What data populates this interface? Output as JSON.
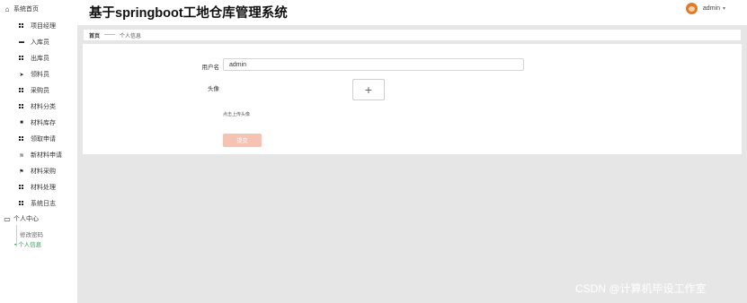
{
  "app": {
    "title": "基于springboot工地仓库管理系统"
  },
  "user": {
    "name": "admin",
    "caret": "▾"
  },
  "sidebar": {
    "home": {
      "label": "系统首页",
      "icon": "home-icon"
    },
    "items": [
      {
        "label": "项目经理",
        "icon": "grid-icon"
      },
      {
        "label": "入库员",
        "icon": "monitor-icon"
      },
      {
        "label": "出库员",
        "icon": "grid-icon"
      },
      {
        "label": "领料员",
        "icon": "send-icon"
      },
      {
        "label": "采购员",
        "icon": "grid-icon"
      },
      {
        "label": "材料分类",
        "icon": "grid-icon"
      },
      {
        "label": "材料库存",
        "icon": "archive-icon"
      },
      {
        "label": "领取申请",
        "icon": "grid-icon"
      },
      {
        "label": "新材料申请",
        "icon": "sliders-icon"
      },
      {
        "label": "材料采购",
        "icon": "flag-icon"
      },
      {
        "label": "材料处理",
        "icon": "grid-icon"
      },
      {
        "label": "系统日志",
        "icon": "grid-icon"
      }
    ],
    "personal": {
      "label": "个人中心",
      "icon": "window-icon"
    },
    "sub": [
      {
        "label": "修改密码",
        "active": false
      },
      {
        "label": "个人信息",
        "active": true
      }
    ]
  },
  "breadcrumb": {
    "home": "首页",
    "sep": "——",
    "current": "个人信息"
  },
  "form": {
    "username_label": "用户名",
    "username_value": "admin",
    "avatar_label": "头像",
    "upload_symbol": "+",
    "upload_hint": "点击上传头像",
    "submit_label": "提交"
  },
  "watermark": "CSDN @计算机毕设工作室",
  "colors": {
    "accent": "#2e9e4f",
    "submit_bg": "#f6c3b3",
    "page_bg": "#e6e6e6"
  }
}
